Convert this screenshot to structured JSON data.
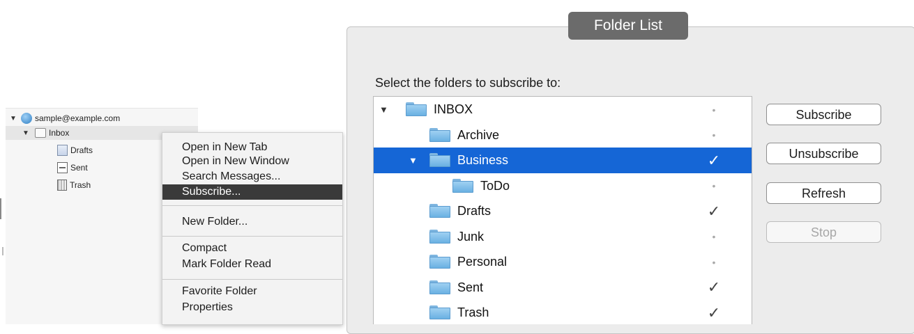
{
  "tree": {
    "account": "sample@example.com",
    "inbox": "Inbox",
    "children": [
      "Drafts",
      "Sent",
      "Trash"
    ]
  },
  "context_menu": {
    "items": [
      "Open in New Tab",
      "Open in New Window",
      "Search Messages...",
      "Subscribe...",
      "New Folder...",
      "Compact",
      "Mark Folder Read",
      "Favorite Folder",
      "Properties"
    ],
    "highlighted": "Subscribe..."
  },
  "dialog": {
    "title": "Folder List",
    "instructions": "Select the folders to subscribe to:",
    "folders": [
      {
        "name": "INBOX",
        "subscribed": false
      },
      {
        "name": "Archive",
        "subscribed": false
      },
      {
        "name": "Business",
        "subscribed": true,
        "selected": true
      },
      {
        "name": "ToDo",
        "subscribed": false
      },
      {
        "name": "Drafts",
        "subscribed": true
      },
      {
        "name": "Junk",
        "subscribed": false
      },
      {
        "name": "Personal",
        "subscribed": false
      },
      {
        "name": "Sent",
        "subscribed": true
      },
      {
        "name": "Trash",
        "subscribed": true
      }
    ],
    "buttons": {
      "subscribe": "Subscribe",
      "unsubscribe": "Unsubscribe",
      "refresh": "Refresh",
      "stop": "Stop"
    },
    "checkmark_glyph": "✓",
    "unsubscribed_glyph": "•",
    "selection_color": "#1566d6"
  }
}
